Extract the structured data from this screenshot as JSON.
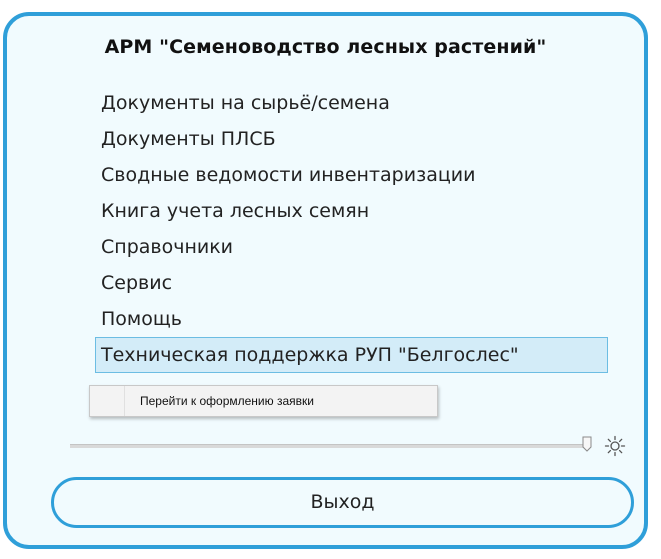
{
  "window": {
    "title": "АРМ \"Семеноводство лесных растений\""
  },
  "menu": {
    "items": [
      {
        "label": "Документы на сырьё/семена"
      },
      {
        "label": "Документы ПЛСБ"
      },
      {
        "label": "Сводные ведомости инвентаризации"
      },
      {
        "label": "Книга учета лесных семян"
      },
      {
        "label": "Справочники"
      },
      {
        "label": "Сервис"
      },
      {
        "label": "Помощь"
      },
      {
        "label": "Техническая поддержка РУП \"Белгослес\""
      }
    ],
    "highlighted_index": 7
  },
  "submenu": {
    "items": [
      {
        "label": "Перейти к оформлению заявки"
      }
    ]
  },
  "brightness_slider": {
    "value": 1.0,
    "icon": "sun-icon"
  },
  "exit_button": {
    "label": "Выход"
  },
  "colors": {
    "accent": "#2f9fd9",
    "background": "#f1fbfe",
    "highlight": "#d3ecf8"
  }
}
